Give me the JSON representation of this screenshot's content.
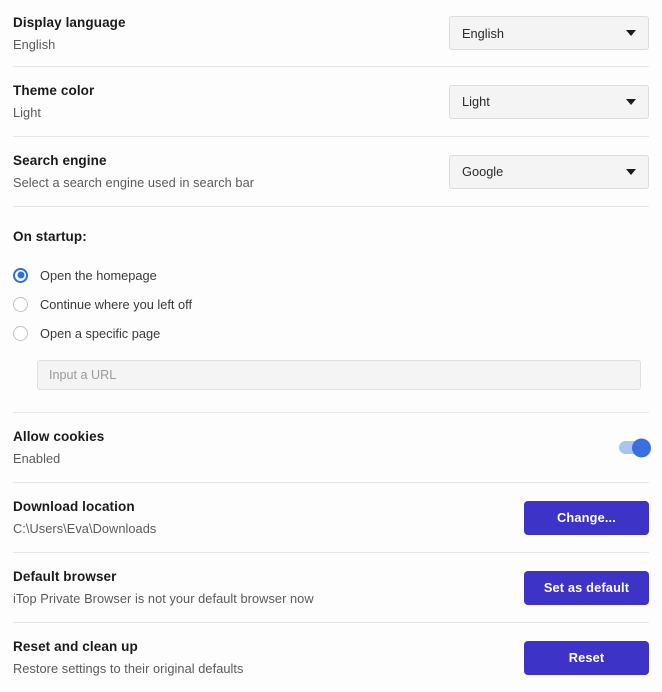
{
  "settings": {
    "display_language": {
      "title": "Display language",
      "subtitle": "English",
      "control_value": "English"
    },
    "theme_color": {
      "title": "Theme color",
      "subtitle": "Light",
      "control_value": "Light"
    },
    "search_engine": {
      "title": "Search engine",
      "subtitle": "Select a search engine used in search bar",
      "control_value": "Google"
    },
    "on_startup": {
      "heading": "On startup:",
      "options": [
        {
          "label": "Open the homepage",
          "selected": true
        },
        {
          "label": "Continue where you left off",
          "selected": false
        },
        {
          "label": "Open a specific page",
          "selected": false
        }
      ],
      "url_placeholder": "Input a URL",
      "url_value": ""
    },
    "allow_cookies": {
      "title": "Allow cookies",
      "subtitle": "Enabled",
      "toggle_on": true
    },
    "download_location": {
      "title": "Download location",
      "subtitle": "C:\\Users\\Eva\\Downloads",
      "button_label": "Change..."
    },
    "default_browser": {
      "title": "Default browser",
      "subtitle": "iTop Private Browser is not your default browser now",
      "button_label": "Set as default"
    },
    "reset_clean_up": {
      "title": "Reset and clean up",
      "subtitle": "Restore settings to their original defaults",
      "button_label": "Reset"
    }
  },
  "colors": {
    "accent_button": "#3d33c6",
    "toggle_on": "#3b6fe0",
    "radio_selected": "#2b6fe0",
    "divider": "#e6e6e6",
    "background": "#fdfdfd"
  },
  "icons": {
    "dropdown_caret": "chevron-down-icon"
  }
}
